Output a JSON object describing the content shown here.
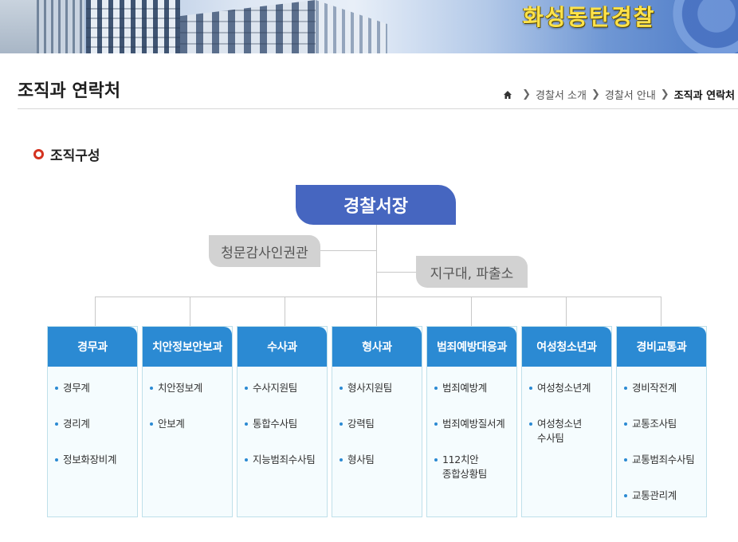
{
  "banner": {
    "title": "화성동탄경찰"
  },
  "page": {
    "title": "조직과 연락처"
  },
  "breadcrumb": {
    "items": [
      "경찰서 소개",
      "경찰서 안내"
    ],
    "current": "조직과 연락처"
  },
  "section": {
    "title": "조직구성"
  },
  "org": {
    "chief": "경찰서장",
    "side_left": "청문감사인권관",
    "side_right": "지구대, 파출소",
    "departments": [
      {
        "name": "경무과",
        "teams": [
          "경무계",
          "경리계",
          "정보화장비계"
        ]
      },
      {
        "name": "치안정보안보과",
        "teams": [
          "치안정보계",
          "안보계"
        ]
      },
      {
        "name": "수사과",
        "teams": [
          "수사지원팀",
          "통합수사팀",
          "지능범죄수사팀"
        ]
      },
      {
        "name": "형사과",
        "teams": [
          "형사지원팀",
          "강력팀",
          "형사팀"
        ]
      },
      {
        "name": "범죄예방대응과",
        "teams": [
          "범죄예방계",
          "범죄예방질서계",
          "112치안\n종합상황팀"
        ]
      },
      {
        "name": "여성청소년과",
        "teams": [
          "여성청소년계",
          "여성청소년\n수사팀"
        ]
      },
      {
        "name": "경비교통과",
        "teams": [
          "경비작전계",
          "교통조사팀",
          "교통범죄수사팀",
          "교통관리계"
        ]
      }
    ]
  },
  "colors": {
    "chief_bg": "#4666c0",
    "dept_header_bg": "#2b8ad3",
    "gray_box_bg": "#d2d2d2",
    "bullet_red": "#d4321f",
    "banner_title": "#ffe34a"
  },
  "icons": {
    "home": "home-icon",
    "separator": "chevron-right-icon",
    "section_bullet": "circle-bullet-icon"
  }
}
